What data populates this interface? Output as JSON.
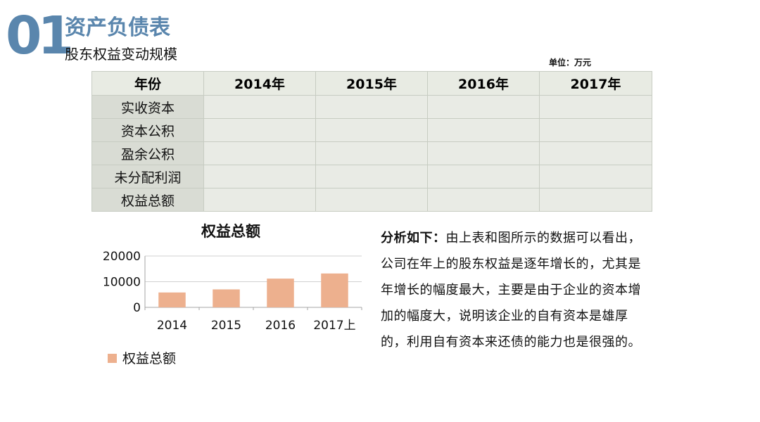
{
  "header": {
    "section_number": "01",
    "title": "资产负债表",
    "subtitle": "股东权益变动规模"
  },
  "unit_note": "单位：万元",
  "table": {
    "headers": [
      "年份",
      "2014年",
      "2015年",
      "2016年",
      "2017年"
    ],
    "rows": [
      {
        "label": "实收资本",
        "cells": [
          "",
          "",
          "",
          ""
        ]
      },
      {
        "label": "资本公积",
        "cells": [
          "",
          "",
          "",
          ""
        ]
      },
      {
        "label": "盈余公积",
        "cells": [
          "",
          "",
          "",
          ""
        ]
      },
      {
        "label": "未分配利润",
        "cells": [
          "",
          "",
          "",
          ""
        ]
      },
      {
        "label": "权益总额",
        "cells": [
          "",
          "",
          "",
          ""
        ]
      }
    ]
  },
  "chart_data": {
    "type": "bar",
    "title": "权益总额",
    "categories": [
      "2014",
      "2015",
      "2016",
      "2017上"
    ],
    "series": [
      {
        "name": "权益总额",
        "values": [
          5800,
          7000,
          11200,
          13200
        ]
      }
    ],
    "ylim": [
      0,
      20000
    ],
    "yticks": [
      0,
      10000,
      20000
    ],
    "xlabel": "",
    "ylabel": "",
    "grid": true,
    "legend": "bottom-left",
    "bar_color": "#edb08e"
  },
  "analysis": {
    "lead": "分析如下：",
    "body": "由上表和图所示的数据可以看出，公司在年上的股东权益是逐年增长的，尤其是年增长的幅度最大，主要是由于企业的资本增加的幅度大，说明该企业的自有资本是雄厚的，利用自有资本来还债的能力也是很强的。"
  }
}
